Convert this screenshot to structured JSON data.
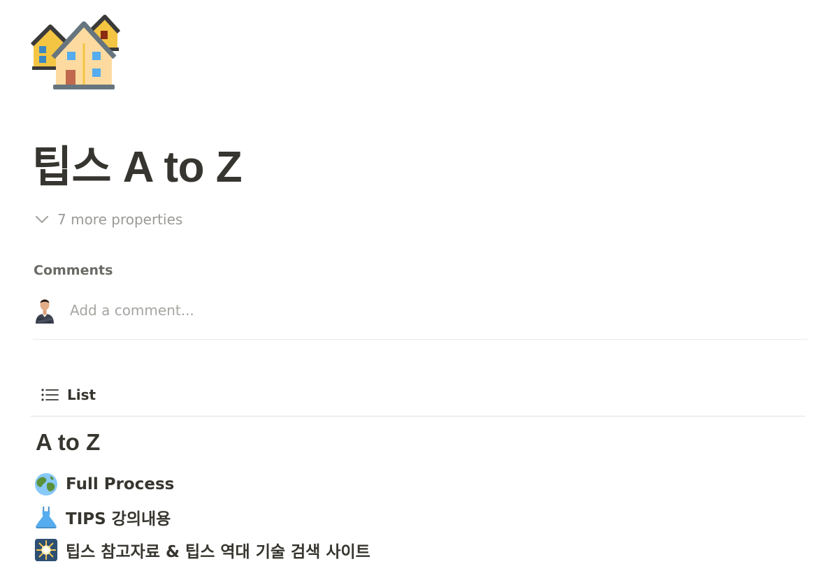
{
  "page": {
    "icon": "houses-icon",
    "title": "팁스 A to Z"
  },
  "properties": {
    "toggle_label": "7 more properties",
    "icon": "chevron-down-icon"
  },
  "comments": {
    "heading": "Comments",
    "placeholder": "Add a comment...",
    "avatar_icon": "user-avatar"
  },
  "views": {
    "active": {
      "icon": "list-icon",
      "label": "List"
    }
  },
  "group": {
    "heading": "A to Z",
    "items": [
      {
        "icon": "globe-icon",
        "label": "Full Process"
      },
      {
        "icon": "dress-icon",
        "label": "TIPS 강의내용"
      },
      {
        "icon": "sparkle-icon",
        "label": "팁스 참고자료 & 팁스 역대 기술 검색 사이트"
      }
    ]
  },
  "colors": {
    "text": "#37352f",
    "muted": "#9b9a97",
    "divider": "#e9e9e7"
  }
}
